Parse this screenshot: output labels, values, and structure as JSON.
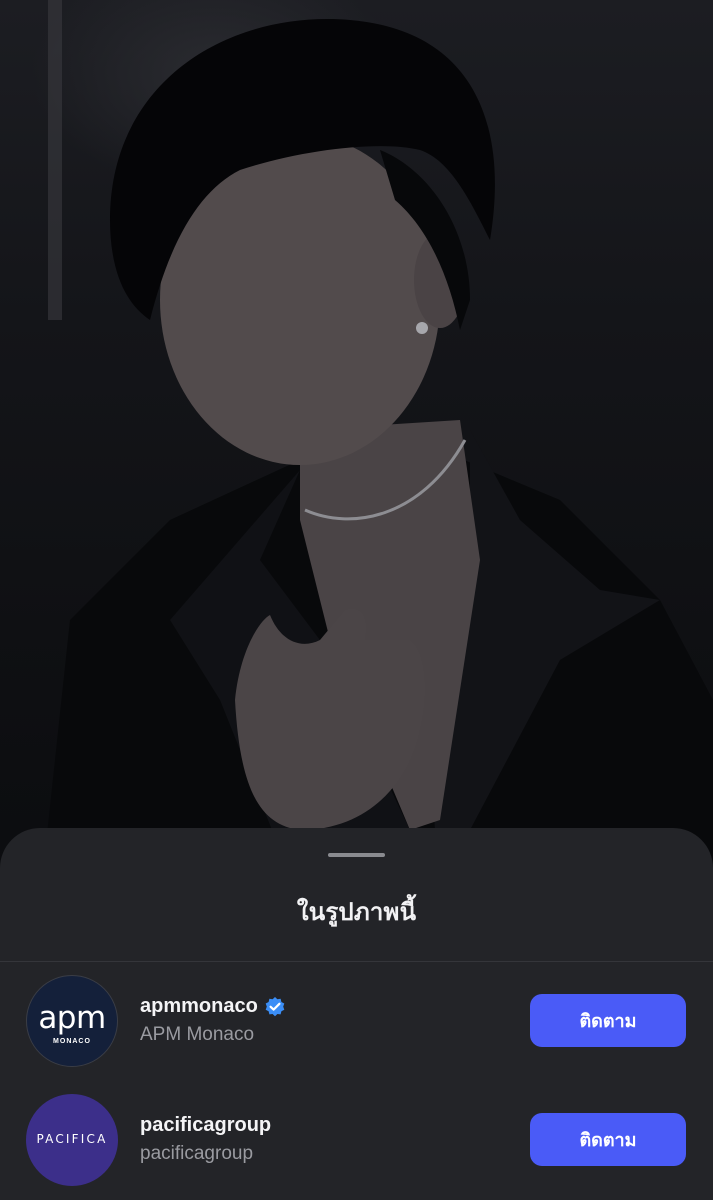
{
  "sheet": {
    "title": "ในรูปภาพนี้",
    "accounts": [
      {
        "username": "apmmonaco",
        "display_name": "APM Monaco",
        "verified": true,
        "avatar_logo_text": "apm",
        "avatar_logo_subtext": "MONACO",
        "follow_label": "ติดตาม"
      },
      {
        "username": "pacificagroup",
        "display_name": "pacificagroup",
        "verified": false,
        "avatar_logo_text": "PACIFICA",
        "follow_label": "ติดตาม"
      }
    ]
  },
  "colors": {
    "sheet_background": "#232428",
    "follow_button": "#4a5bf7",
    "verified_badge": "#3b8ef6",
    "apm_avatar": "#14203a",
    "pacifica_avatar": "#3c2f8a"
  },
  "icons": {
    "verified": "verified-badge-icon"
  }
}
